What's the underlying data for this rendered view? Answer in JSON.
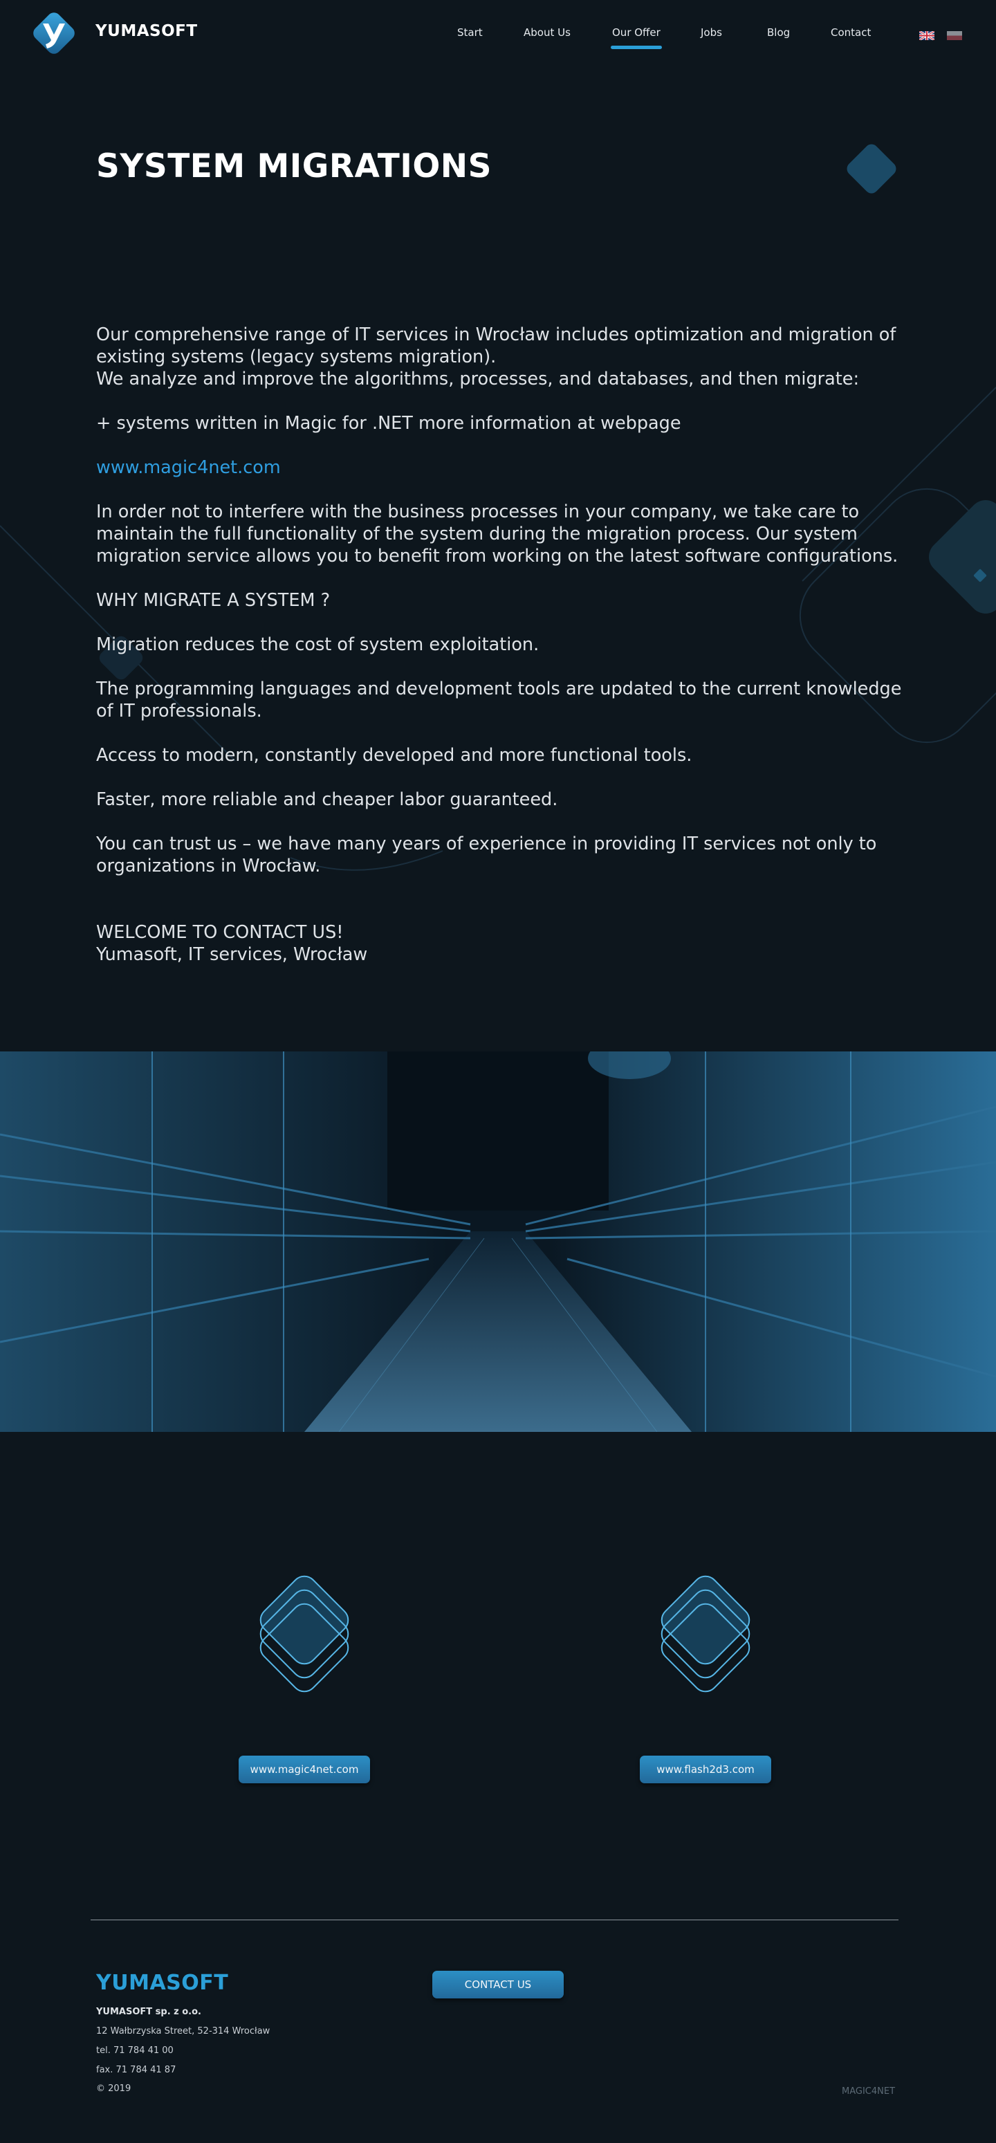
{
  "header": {
    "brand": "YUMASOFT",
    "nav": [
      {
        "label": "Start"
      },
      {
        "label": "About Us"
      },
      {
        "label": "Our Offer",
        "active": true
      },
      {
        "label": "Jobs"
      },
      {
        "label": "Blog"
      },
      {
        "label": "Contact"
      }
    ],
    "languages": [
      "en-flag-icon",
      "pl-flag-icon"
    ]
  },
  "main": {
    "title": "SYSTEM MIGRATIONS",
    "paragraphs": {
      "intro": "Our comprehensive range of IT services in Wrocław includes optimization and migration of existing systems (legacy systems migration).",
      "analyze": "We analyze and improve the algorithms, processes, and databases, and then migrate:",
      "magic": "+ systems written in Magic for .NET more information at webpage",
      "link": "www.magic4net.com",
      "business": "In order not to interfere with the business processes in your company, we take care to maintain the full functionality of the system during the migration process. Our system migration service allows you to benefit from working on the latest software configurations.",
      "why": "WHY MIGRATE A SYSTEM ?",
      "cost": "Migration reduces the cost of system exploitation.",
      "languages": "The programming languages and development tools are updated to the current knowledge of IT professionals.",
      "access": "Access to modern, constantly developed and more functional tools.",
      "faster": "Faster, more reliable and cheaper labor guaranteed.",
      "trust": "You can trust us – we have many years of experience in providing IT services not only to organizations in Wrocław.",
      "welcome": "WELCOME TO CONTACT US!",
      "signature": "Yumasoft, IT services, Wrocław"
    }
  },
  "partners": [
    {
      "label": "www.magic4net.com"
    },
    {
      "label": "www.flash2d3.com"
    }
  ],
  "footer": {
    "logo": "YUMASOFT",
    "company": "YUMASOFT sp. z o.o.",
    "address": "12 Wałbrzyska Street, 52-314 Wrocław",
    "phone": "tel. 71 784 41 00",
    "fax": "fax. 71 784 41 87",
    "copyright": "© 2019",
    "contact_button": "CONTACT US",
    "partner_brand": "MAGIC4NET"
  },
  "colors": {
    "background": "#0d161d",
    "accent": "#2b9fd8",
    "text": "#dfe3e7"
  }
}
